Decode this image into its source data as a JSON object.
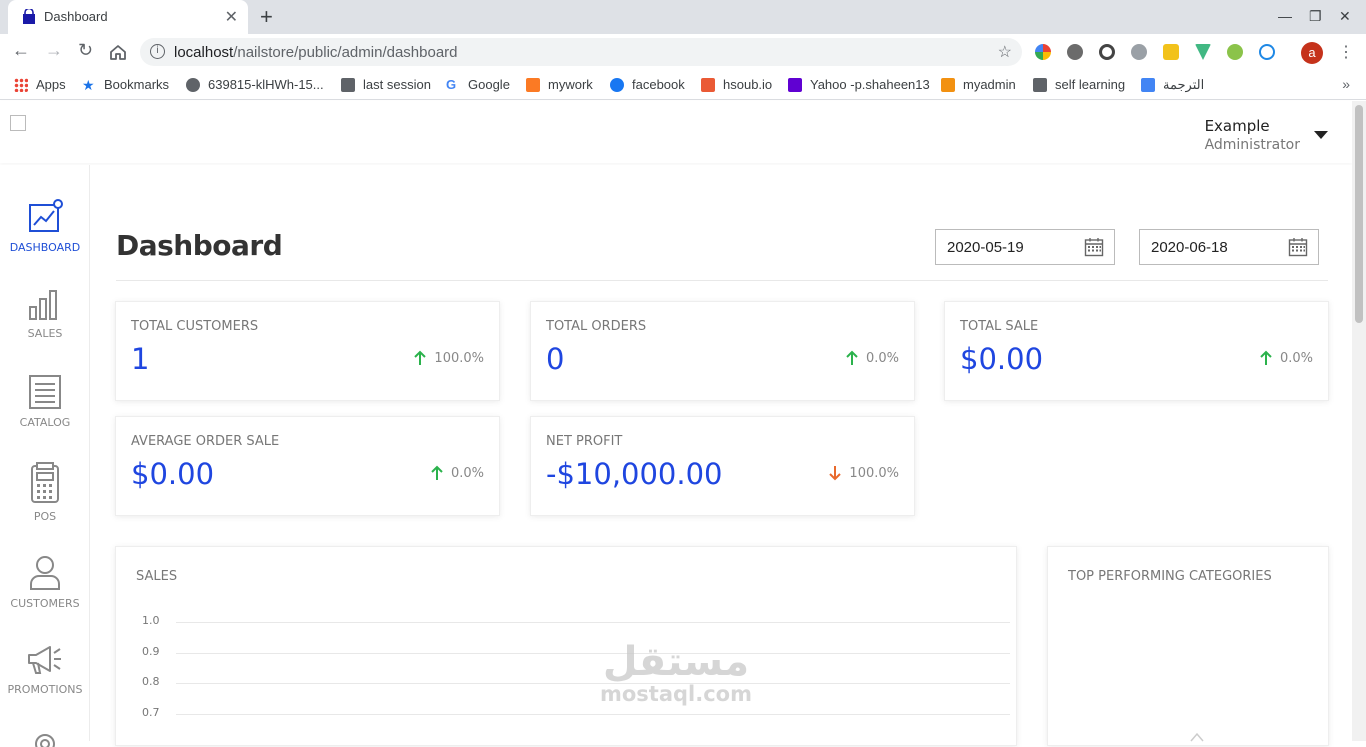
{
  "browser": {
    "tab_title": "Dashboard",
    "url_host": "localhost",
    "url_path": "/nailstore/public/admin/dashboard",
    "profile_initial": "a",
    "bookmarks": [
      "Apps",
      "Bookmarks",
      "639815-klHWh-15...",
      "last session",
      "Google",
      "mywork",
      "facebook",
      "hsoub.io",
      "Yahoo -p.shaheen13",
      "myadmin",
      "self learning",
      "الترجمة"
    ]
  },
  "header": {
    "user_name": "Example",
    "user_role": "Administrator"
  },
  "sidebar": {
    "items": [
      {
        "label": "DASHBOARD",
        "icon": "chart-line-icon",
        "active": true
      },
      {
        "label": "SALES",
        "icon": "bar-chart-icon",
        "active": false
      },
      {
        "label": "CATALOG",
        "icon": "list-document-icon",
        "active": false
      },
      {
        "label": "POS",
        "icon": "calculator-icon",
        "active": false
      },
      {
        "label": "CUSTOMERS",
        "icon": "user-icon",
        "active": false
      },
      {
        "label": "PROMOTIONS",
        "icon": "megaphone-icon",
        "active": false
      }
    ]
  },
  "main": {
    "title": "Dashboard",
    "date_from": "2020-05-19",
    "date_to": "2020-06-18",
    "stats": [
      {
        "label": "TOTAL CUSTOMERS",
        "value": "1",
        "trend": "100.0%",
        "direction": "up"
      },
      {
        "label": "TOTAL ORDERS",
        "value": "0",
        "trend": "0.0%",
        "direction": "up"
      },
      {
        "label": "TOTAL SALE",
        "value": "$0.00",
        "trend": "0.0%",
        "direction": "up"
      },
      {
        "label": "AVERAGE ORDER SALE",
        "value": "$0.00",
        "trend": "0.0%",
        "direction": "up"
      },
      {
        "label": "NET PROFIT",
        "value": "-$10,000.00",
        "trend": "100.0%",
        "direction": "down"
      }
    ],
    "sales_panel": {
      "title": "SALES",
      "y_ticks": [
        "1.0",
        "0.9",
        "0.8",
        "0.7"
      ]
    },
    "categories_panel": {
      "title": "TOP PERFORMING CATEGORIES"
    }
  },
  "watermark": {
    "arabic": "مستقل",
    "latin": "mostaql.com"
  },
  "colors": {
    "accent": "#1f46e0",
    "up": "#2bb24c",
    "down": "#e8692c"
  }
}
